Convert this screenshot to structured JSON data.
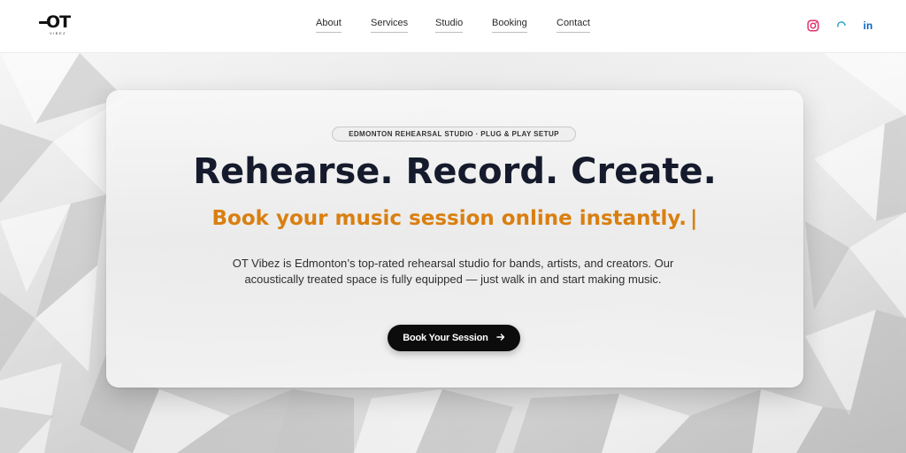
{
  "header": {
    "logo": {
      "mark": "OT",
      "sub": "VIBEZ"
    },
    "nav": [
      {
        "label": "About"
      },
      {
        "label": "Services"
      },
      {
        "label": "Studio"
      },
      {
        "label": "Booking"
      },
      {
        "label": "Contact"
      }
    ],
    "social": [
      {
        "icon": "instagram-icon",
        "color": "#e1306c"
      },
      {
        "icon": "tiktok-icon",
        "color": "#25a0c8"
      },
      {
        "icon": "linkedin-icon",
        "label": "in",
        "color": "#0a66c2"
      }
    ]
  },
  "hero": {
    "badge": "EDMONTON REHEARSAL STUDIO · PLUG & PLAY SETUP",
    "title": "Rehearse. Record. Create.",
    "subtitle": "Book your music session online instantly.",
    "cursor": "|",
    "description": "OT Vibez is Edmonton’s top-rated rehearsal studio for bands, artists, and creators. Our acoustically treated space is fully equipped — just walk in and start making music.",
    "cta_label": "Book Your Session",
    "cta_icon": "arrow-right-icon"
  },
  "colors": {
    "accent": "#d97f10",
    "title": "#151b2c",
    "button": "#0c0c0c"
  }
}
